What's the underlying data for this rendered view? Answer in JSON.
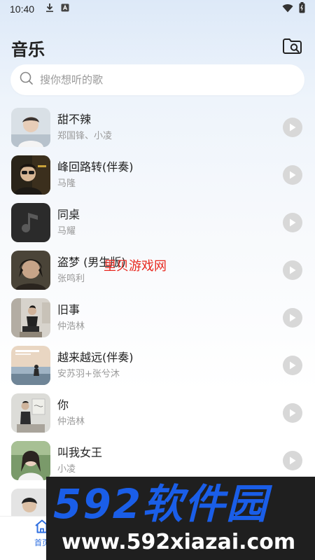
{
  "status_bar": {
    "time": "10:40",
    "left_icons": [
      "download-icon",
      "notification-a-icon"
    ],
    "right_icons": [
      "wifi-icon",
      "battery-icon"
    ]
  },
  "header": {
    "title": "音乐",
    "action_icon": "folder-search-icon"
  },
  "search": {
    "placeholder": "搜你想听的歌",
    "value": ""
  },
  "songs": [
    {
      "title": "甜不辣",
      "artist": "郑国锋、小凌"
    },
    {
      "title": "峰回路转(伴奏)",
      "artist": "马隆"
    },
    {
      "title": "同桌",
      "artist": "马耀"
    },
    {
      "title": "盗梦 (男生版)",
      "artist": "张鸣利"
    },
    {
      "title": "旧事",
      "artist": "仲浩林"
    },
    {
      "title": "越来越远(伴奏)",
      "artist": "安苏羽+张兮沐"
    },
    {
      "title": "你",
      "artist": "仲浩林"
    },
    {
      "title": "叫我女王",
      "artist": "小凌"
    }
  ],
  "bottom_nav": {
    "home_label": "首页"
  },
  "overlays": {
    "red_watermark": "里贝游戏网",
    "brand": "592软件园",
    "url": "www.592xiazai.com"
  },
  "colors": {
    "accent": "#2f6fe0",
    "play_button": "#d8d8d8",
    "brand_blue": "#1a5ee8"
  }
}
